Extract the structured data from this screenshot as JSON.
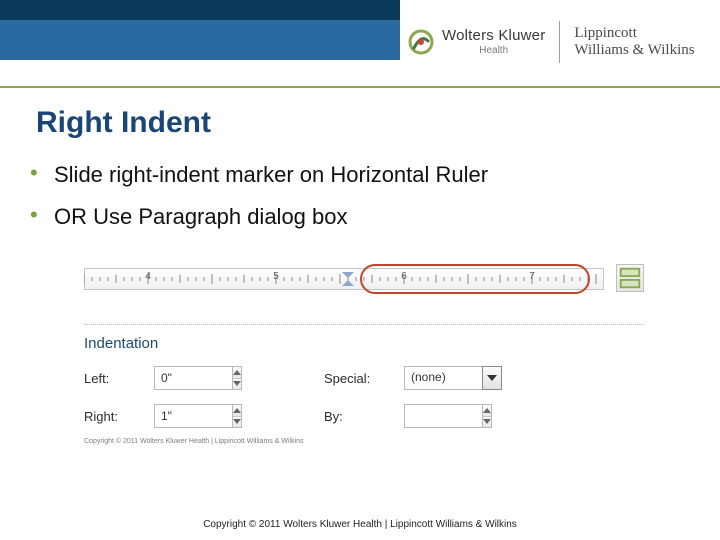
{
  "brand": {
    "left_main": "Wolters Kluwer",
    "left_sub": "Health",
    "right_line1": "Lippincott",
    "right_line2": "Williams & Wilkins"
  },
  "slide": {
    "title": "Right Indent",
    "bullets": [
      "Slide right-indent marker on Horizontal Ruler",
      "OR Use Paragraph dialog box"
    ]
  },
  "ruler": {
    "numbers": [
      "4",
      "5",
      "6",
      "7"
    ]
  },
  "panel": {
    "section_title": "Indentation",
    "left_label": "Left:",
    "left_value": "0\"",
    "right_label": "Right:",
    "right_value": "1\"",
    "special_label": "Special:",
    "special_value": "(none)",
    "by_label": "By:",
    "by_value": ""
  },
  "tiny_copyright": "Copyright © 2011 Wolters Kluwer Health | Lippincott Williams & Wilkins",
  "footer": "Copyright © 2011 Wolters Kluwer Health | Lippincott Williams & Wilkins"
}
